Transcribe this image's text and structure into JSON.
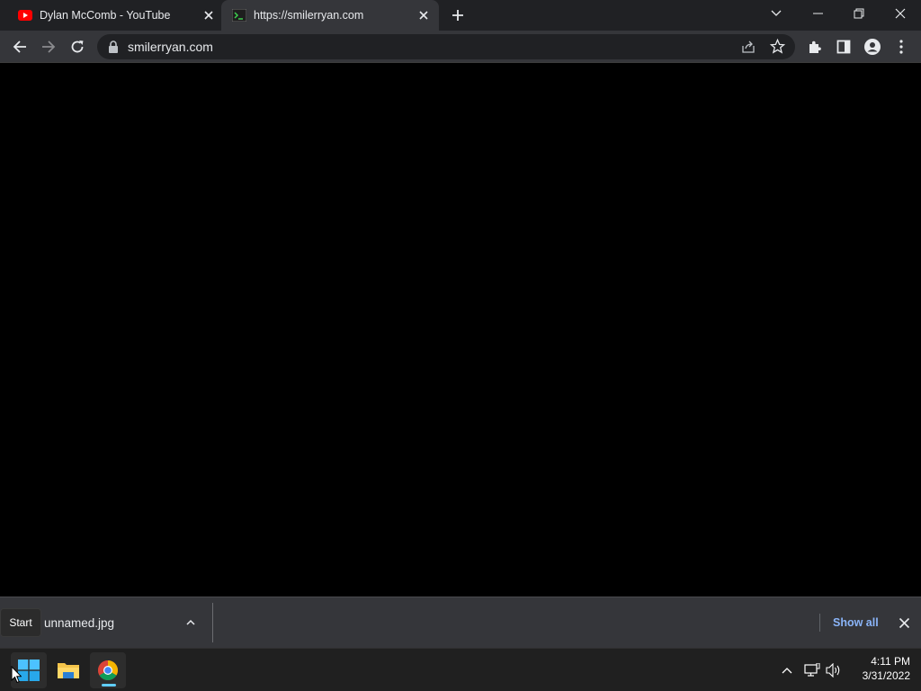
{
  "browser": {
    "tabs": [
      {
        "title": "Dylan McComb - YouTube",
        "favicon": "youtube-icon",
        "active": false
      },
      {
        "title": "https://smilerryan.com",
        "favicon": "terminal-icon",
        "active": true
      }
    ],
    "address_bar": {
      "url": "smilerryan.com",
      "secure_icon": "lock-icon"
    },
    "toolbar_icons": [
      "back-arrow-icon",
      "forward-arrow-icon",
      "reload-icon",
      "share-icon",
      "star-icon",
      "extensions-icon",
      "side-panel-icon",
      "profile-icon",
      "menu-icon"
    ]
  },
  "downloads": {
    "file_name": "unnamed.jpg",
    "show_all_label": "Show all"
  },
  "taskbar": {
    "start_tooltip": "Start",
    "apps": [
      "windows-start-icon",
      "file-explorer-icon",
      "chrome-icon"
    ],
    "clock": {
      "time": "4:11 PM",
      "date": "3/31/2022"
    }
  },
  "colors": {
    "link_blue": "#8ab4f8",
    "tab_strip": "#202124",
    "toolbar": "#35363a",
    "taskbar": "#202020",
    "youtube_red": "#ff0000"
  }
}
